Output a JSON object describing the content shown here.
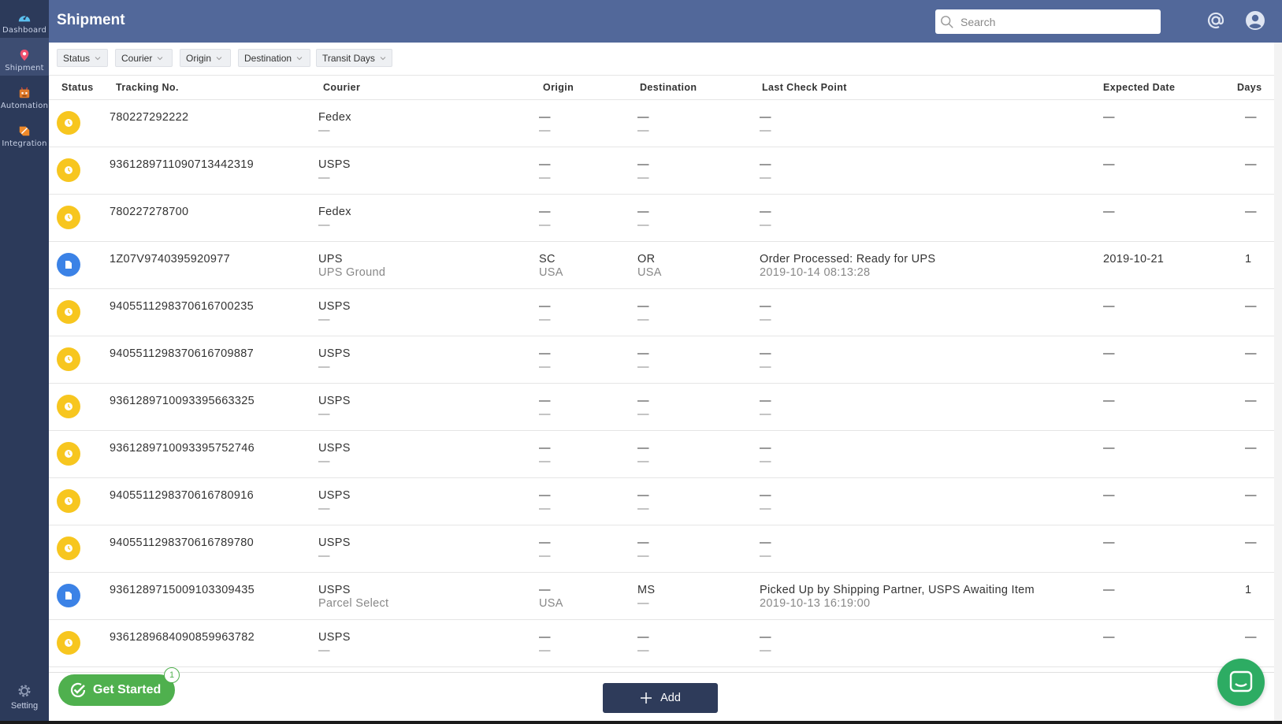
{
  "sidebar": {
    "items": [
      {
        "label": "Dashboard",
        "icon": "dashboard-icon"
      },
      {
        "label": "Shipment",
        "icon": "location-pin-icon"
      },
      {
        "label": "Automation",
        "icon": "robot-icon"
      },
      {
        "label": "Integration",
        "icon": "integration-icon"
      }
    ],
    "setting_label": "Setting"
  },
  "header": {
    "title": "Shipment",
    "search_placeholder": "Search"
  },
  "filters": [
    "Status",
    "Courier",
    "Origin",
    "Destination",
    "Transit Days"
  ],
  "table": {
    "columns": [
      "Status",
      "Tracking No.",
      "Courier",
      "Origin",
      "Destination",
      "Last Check Point",
      "Expected Date",
      "Days"
    ],
    "rows": [
      {
        "status": "pending",
        "tracking": "780227292222",
        "courier": "Fedex",
        "courier_sub": "—",
        "origin": "—",
        "origin_sub": "—",
        "dest": "—",
        "dest_sub": "—",
        "checkpoint": "—",
        "checkpoint_sub": "—",
        "expected": "—",
        "days": "—"
      },
      {
        "status": "pending",
        "tracking": "9361289711090713442319",
        "courier": "USPS",
        "courier_sub": "—",
        "origin": "—",
        "origin_sub": "—",
        "dest": "—",
        "dest_sub": "—",
        "checkpoint": "—",
        "checkpoint_sub": "—",
        "expected": "—",
        "days": "—"
      },
      {
        "status": "pending",
        "tracking": "780227278700",
        "courier": "Fedex",
        "courier_sub": "—",
        "origin": "—",
        "origin_sub": "—",
        "dest": "—",
        "dest_sub": "—",
        "checkpoint": "—",
        "checkpoint_sub": "—",
        "expected": "—",
        "days": "—"
      },
      {
        "status": "info",
        "tracking": "1Z07V9740395920977",
        "courier": "UPS",
        "courier_sub": "UPS Ground",
        "origin": "SC",
        "origin_sub": "USA",
        "dest": "OR",
        "dest_sub": "USA",
        "checkpoint": "Order Processed: Ready for UPS",
        "checkpoint_sub": "2019-10-14 08:13:28",
        "expected": "2019-10-21",
        "days": "1"
      },
      {
        "status": "pending",
        "tracking": "9405511298370616700235",
        "courier": "USPS",
        "courier_sub": "—",
        "origin": "—",
        "origin_sub": "—",
        "dest": "—",
        "dest_sub": "—",
        "checkpoint": "—",
        "checkpoint_sub": "—",
        "expected": "—",
        "days": "—"
      },
      {
        "status": "pending",
        "tracking": "9405511298370616709887",
        "courier": "USPS",
        "courier_sub": "—",
        "origin": "—",
        "origin_sub": "—",
        "dest": "—",
        "dest_sub": "—",
        "checkpoint": "—",
        "checkpoint_sub": "—",
        "expected": "—",
        "days": "—"
      },
      {
        "status": "pending",
        "tracking": "9361289710093395663325",
        "courier": "USPS",
        "courier_sub": "—",
        "origin": "—",
        "origin_sub": "—",
        "dest": "—",
        "dest_sub": "—",
        "checkpoint": "—",
        "checkpoint_sub": "—",
        "expected": "—",
        "days": "—"
      },
      {
        "status": "pending",
        "tracking": "9361289710093395752746",
        "courier": "USPS",
        "courier_sub": "—",
        "origin": "—",
        "origin_sub": "—",
        "dest": "—",
        "dest_sub": "—",
        "checkpoint": "—",
        "checkpoint_sub": "—",
        "expected": "—",
        "days": "—"
      },
      {
        "status": "pending",
        "tracking": "9405511298370616780916",
        "courier": "USPS",
        "courier_sub": "—",
        "origin": "—",
        "origin_sub": "—",
        "dest": "—",
        "dest_sub": "—",
        "checkpoint": "—",
        "checkpoint_sub": "—",
        "expected": "—",
        "days": "—"
      },
      {
        "status": "pending",
        "tracking": "9405511298370616789780",
        "courier": "USPS",
        "courier_sub": "—",
        "origin": "—",
        "origin_sub": "—",
        "dest": "—",
        "dest_sub": "—",
        "checkpoint": "—",
        "checkpoint_sub": "—",
        "expected": "—",
        "days": "—"
      },
      {
        "status": "info",
        "tracking": "9361289715009103309435",
        "courier": "USPS",
        "courier_sub": "Parcel Select",
        "origin": "—",
        "origin_sub": "USA",
        "dest": "MS",
        "dest_sub": "—",
        "checkpoint": "Picked Up by Shipping Partner, USPS Awaiting Item",
        "checkpoint_sub": "2019-10-13 16:19:00",
        "expected": "—",
        "days": "1"
      },
      {
        "status": "pending",
        "tracking": "9361289684090859963782",
        "courier": "USPS",
        "courier_sub": "—",
        "origin": "—",
        "origin_sub": "—",
        "dest": "—",
        "dest_sub": "—",
        "checkpoint": "—",
        "checkpoint_sub": "—",
        "expected": "—",
        "days": "—"
      }
    ]
  },
  "footer": {
    "add_label": "Add",
    "get_started_label": "Get Started",
    "get_started_badge": "1"
  },
  "colors": {
    "sidebar_bg": "#2c3a5a",
    "header_bg": "#52689a",
    "pending": "#f7c61f",
    "info": "#3b82e6",
    "get_started": "#4fb04e",
    "chat": "#2dac63",
    "add_button": "#2e3b5a"
  }
}
